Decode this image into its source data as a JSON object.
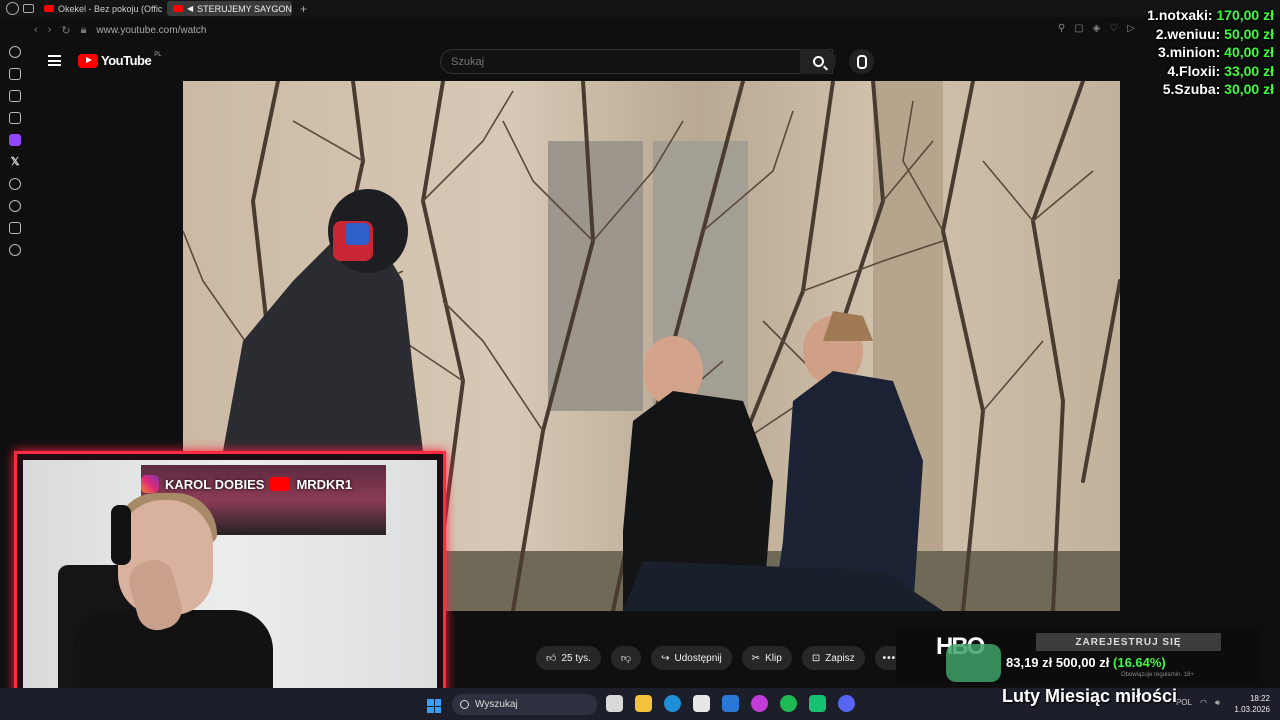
{
  "browser": {
    "tabs": [
      {
        "label": "Okekel - Bez pokoju (Offic"
      },
      {
        "label": "STERUJEMY SAYGON"
      }
    ],
    "url": "www.youtube.com/watch"
  },
  "youtube": {
    "logo_text": "YouTube",
    "region": "PL",
    "search_placeholder": "Szukaj"
  },
  "actions": {
    "like_count": "25 tys.",
    "share": "Udostępnij",
    "clip": "Klip",
    "save": "Zapisz",
    "more": "•••"
  },
  "ranking": [
    {
      "name": "1.notxaki:",
      "amount": "170,00 zł"
    },
    {
      "name": "2.weniuu:",
      "amount": "50,00 zł"
    },
    {
      "name": "3.minion:",
      "amount": "40,00 zł"
    },
    {
      "name": "4.Floxii:",
      "amount": "33,00 zł"
    },
    {
      "name": "5.Szuba:",
      "amount": "30,00 zł"
    }
  ],
  "overlay": {
    "instagram": "KAROL DOBIES",
    "youtube": "MRDKR1"
  },
  "ad": {
    "brand": "HBO",
    "cta": "ZAREJESTRUJ SIĘ",
    "raised": "83,19 zł",
    "goal": "500,00 zł",
    "percent": "(16.64%)",
    "fineprint": "Obowiązuje regulamin. 18+"
  },
  "promo_text": "Luty Miesiąc miłości",
  "taskbar": {
    "search": "Wyszukaj",
    "lang": "POL",
    "time": "18:22",
    "date": "1.03.2026"
  },
  "colors": {
    "accent_red": "#ff2a43",
    "money_green": "#3dfc3d",
    "youtube_red": "#ff0000"
  }
}
